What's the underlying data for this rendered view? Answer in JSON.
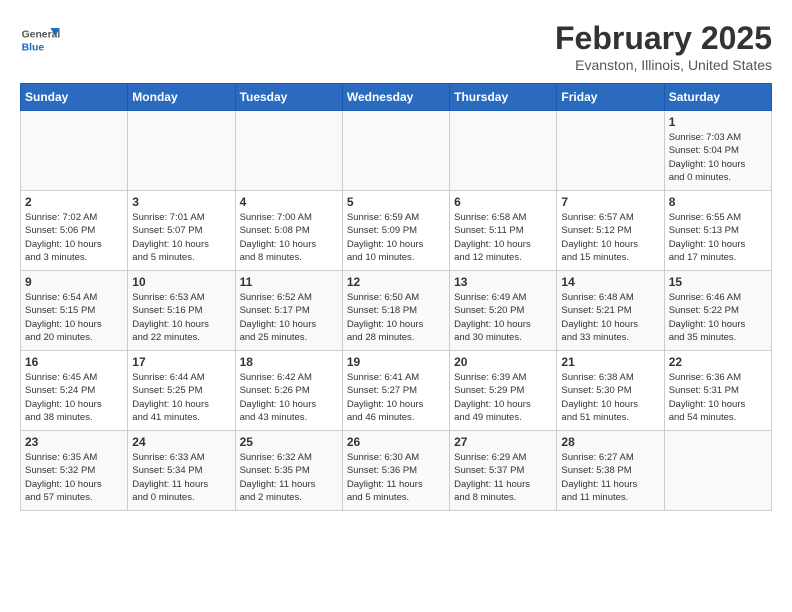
{
  "header": {
    "logo_general": "General",
    "logo_blue": "Blue",
    "title": "February 2025",
    "subtitle": "Evanston, Illinois, United States"
  },
  "days_of_week": [
    "Sunday",
    "Monday",
    "Tuesday",
    "Wednesday",
    "Thursday",
    "Friday",
    "Saturday"
  ],
  "weeks": [
    {
      "days": [
        {
          "num": "",
          "info": ""
        },
        {
          "num": "",
          "info": ""
        },
        {
          "num": "",
          "info": ""
        },
        {
          "num": "",
          "info": ""
        },
        {
          "num": "",
          "info": ""
        },
        {
          "num": "",
          "info": ""
        },
        {
          "num": "1",
          "info": "Sunrise: 7:03 AM\nSunset: 5:04 PM\nDaylight: 10 hours\nand 0 minutes."
        }
      ]
    },
    {
      "days": [
        {
          "num": "2",
          "info": "Sunrise: 7:02 AM\nSunset: 5:06 PM\nDaylight: 10 hours\nand 3 minutes."
        },
        {
          "num": "3",
          "info": "Sunrise: 7:01 AM\nSunset: 5:07 PM\nDaylight: 10 hours\nand 5 minutes."
        },
        {
          "num": "4",
          "info": "Sunrise: 7:00 AM\nSunset: 5:08 PM\nDaylight: 10 hours\nand 8 minutes."
        },
        {
          "num": "5",
          "info": "Sunrise: 6:59 AM\nSunset: 5:09 PM\nDaylight: 10 hours\nand 10 minutes."
        },
        {
          "num": "6",
          "info": "Sunrise: 6:58 AM\nSunset: 5:11 PM\nDaylight: 10 hours\nand 12 minutes."
        },
        {
          "num": "7",
          "info": "Sunrise: 6:57 AM\nSunset: 5:12 PM\nDaylight: 10 hours\nand 15 minutes."
        },
        {
          "num": "8",
          "info": "Sunrise: 6:55 AM\nSunset: 5:13 PM\nDaylight: 10 hours\nand 17 minutes."
        }
      ]
    },
    {
      "days": [
        {
          "num": "9",
          "info": "Sunrise: 6:54 AM\nSunset: 5:15 PM\nDaylight: 10 hours\nand 20 minutes."
        },
        {
          "num": "10",
          "info": "Sunrise: 6:53 AM\nSunset: 5:16 PM\nDaylight: 10 hours\nand 22 minutes."
        },
        {
          "num": "11",
          "info": "Sunrise: 6:52 AM\nSunset: 5:17 PM\nDaylight: 10 hours\nand 25 minutes."
        },
        {
          "num": "12",
          "info": "Sunrise: 6:50 AM\nSunset: 5:18 PM\nDaylight: 10 hours\nand 28 minutes."
        },
        {
          "num": "13",
          "info": "Sunrise: 6:49 AM\nSunset: 5:20 PM\nDaylight: 10 hours\nand 30 minutes."
        },
        {
          "num": "14",
          "info": "Sunrise: 6:48 AM\nSunset: 5:21 PM\nDaylight: 10 hours\nand 33 minutes."
        },
        {
          "num": "15",
          "info": "Sunrise: 6:46 AM\nSunset: 5:22 PM\nDaylight: 10 hours\nand 35 minutes."
        }
      ]
    },
    {
      "days": [
        {
          "num": "16",
          "info": "Sunrise: 6:45 AM\nSunset: 5:24 PM\nDaylight: 10 hours\nand 38 minutes."
        },
        {
          "num": "17",
          "info": "Sunrise: 6:44 AM\nSunset: 5:25 PM\nDaylight: 10 hours\nand 41 minutes."
        },
        {
          "num": "18",
          "info": "Sunrise: 6:42 AM\nSunset: 5:26 PM\nDaylight: 10 hours\nand 43 minutes."
        },
        {
          "num": "19",
          "info": "Sunrise: 6:41 AM\nSunset: 5:27 PM\nDaylight: 10 hours\nand 46 minutes."
        },
        {
          "num": "20",
          "info": "Sunrise: 6:39 AM\nSunset: 5:29 PM\nDaylight: 10 hours\nand 49 minutes."
        },
        {
          "num": "21",
          "info": "Sunrise: 6:38 AM\nSunset: 5:30 PM\nDaylight: 10 hours\nand 51 minutes."
        },
        {
          "num": "22",
          "info": "Sunrise: 6:36 AM\nSunset: 5:31 PM\nDaylight: 10 hours\nand 54 minutes."
        }
      ]
    },
    {
      "days": [
        {
          "num": "23",
          "info": "Sunrise: 6:35 AM\nSunset: 5:32 PM\nDaylight: 10 hours\nand 57 minutes."
        },
        {
          "num": "24",
          "info": "Sunrise: 6:33 AM\nSunset: 5:34 PM\nDaylight: 11 hours\nand 0 minutes."
        },
        {
          "num": "25",
          "info": "Sunrise: 6:32 AM\nSunset: 5:35 PM\nDaylight: 11 hours\nand 2 minutes."
        },
        {
          "num": "26",
          "info": "Sunrise: 6:30 AM\nSunset: 5:36 PM\nDaylight: 11 hours\nand 5 minutes."
        },
        {
          "num": "27",
          "info": "Sunrise: 6:29 AM\nSunset: 5:37 PM\nDaylight: 11 hours\nand 8 minutes."
        },
        {
          "num": "28",
          "info": "Sunrise: 6:27 AM\nSunset: 5:38 PM\nDaylight: 11 hours\nand 11 minutes."
        },
        {
          "num": "",
          "info": ""
        }
      ]
    }
  ]
}
